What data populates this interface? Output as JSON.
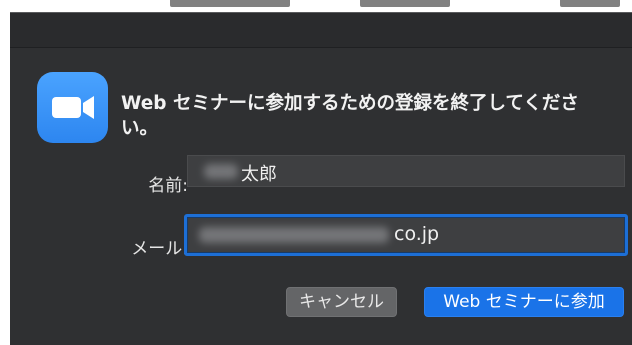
{
  "dialog": {
    "heading": "Web セミナーに参加するための登録を終了してください。",
    "app_icon": "zoom-video-camera-icon"
  },
  "form": {
    "name_label": "名前:",
    "name_value": "太郎",
    "email_label": "メール:",
    "email_value": "co.jp"
  },
  "buttons": {
    "cancel_label": "キャンセル",
    "join_label": "Web セミナーに参加"
  },
  "colors": {
    "dialog_bg": "#2f3032",
    "accent": "#1a73e8",
    "icon_blue": "#2d86f0"
  }
}
